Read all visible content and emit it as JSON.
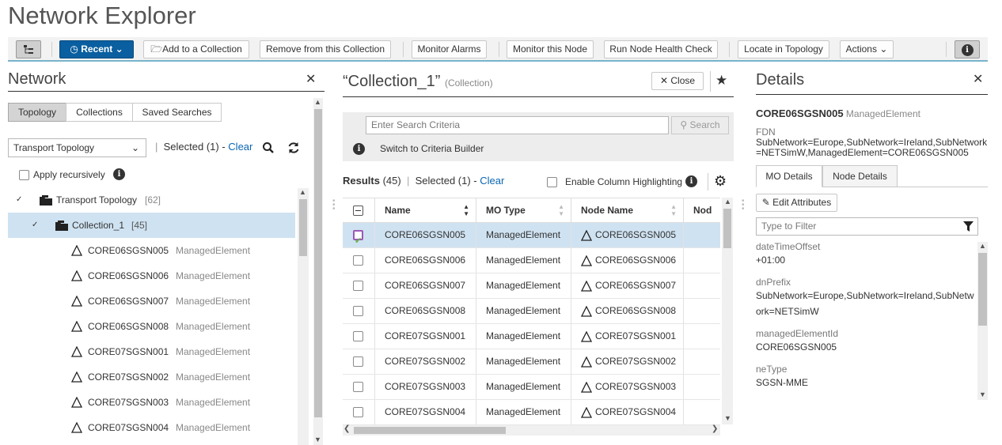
{
  "app": {
    "title": "Network Explorer"
  },
  "toolbar": {
    "recent_label": "Recent",
    "add_collection": "Add to a Collection",
    "remove_collection": "Remove from this Collection",
    "monitor_alarms": "Monitor Alarms",
    "monitor_node": "Monitor this Node",
    "health_check": "Run Node Health Check",
    "locate_topology": "Locate in Topology",
    "actions": "Actions"
  },
  "network": {
    "title": "Network",
    "tabs": [
      "Topology",
      "Collections",
      "Saved Searches"
    ],
    "active_tab": "Topology",
    "topology_select": "Transport Topology",
    "selected_text": "Selected (1) -",
    "clear": "Clear",
    "apply_recursively": "Apply recursively",
    "tree": {
      "root": {
        "label": "Transport Topology",
        "count": "[62]"
      },
      "collection": {
        "label": "Collection_1",
        "count": "[45]"
      },
      "nodes": [
        {
          "name": "CORE06SGSN005",
          "type": "ManagedElement"
        },
        {
          "name": "CORE06SGSN006",
          "type": "ManagedElement"
        },
        {
          "name": "CORE06SGSN007",
          "type": "ManagedElement"
        },
        {
          "name": "CORE06SGSN008",
          "type": "ManagedElement"
        },
        {
          "name": "CORE07SGSN001",
          "type": "ManagedElement"
        },
        {
          "name": "CORE07SGSN002",
          "type": "ManagedElement"
        },
        {
          "name": "CORE07SGSN003",
          "type": "ManagedElement"
        },
        {
          "name": "CORE07SGSN004",
          "type": "ManagedElement"
        }
      ]
    }
  },
  "collection": {
    "title": "“Collection_1”",
    "subtitle": "(Collection)",
    "close_label": "Close",
    "search_placeholder": "Enter Search Criteria",
    "search_button": "Search",
    "criteria_builder": "Switch to Criteria Builder",
    "results_label": "Results",
    "results_count": "(45)",
    "selected_text": "Selected (1) -",
    "clear": "Clear",
    "column_highlighting": "Enable Column Highlighting",
    "columns": [
      "Name",
      "MO Type",
      "Node Name",
      "Nod"
    ],
    "rows": [
      {
        "name": "CORE06SGSN005",
        "mo_type": "ManagedElement",
        "node_name": "CORE06SGSN005",
        "selected": true
      },
      {
        "name": "CORE06SGSN006",
        "mo_type": "ManagedElement",
        "node_name": "CORE06SGSN006",
        "selected": false
      },
      {
        "name": "CORE06SGSN007",
        "mo_type": "ManagedElement",
        "node_name": "CORE06SGSN007",
        "selected": false
      },
      {
        "name": "CORE06SGSN008",
        "mo_type": "ManagedElement",
        "node_name": "CORE06SGSN008",
        "selected": false
      },
      {
        "name": "CORE07SGSN001",
        "mo_type": "ManagedElement",
        "node_name": "CORE07SGSN001",
        "selected": false
      },
      {
        "name": "CORE07SGSN002",
        "mo_type": "ManagedElement",
        "node_name": "CORE07SGSN002",
        "selected": false
      },
      {
        "name": "CORE07SGSN003",
        "mo_type": "ManagedElement",
        "node_name": "CORE07SGSN003",
        "selected": false
      },
      {
        "name": "CORE07SGSN004",
        "mo_type": "ManagedElement",
        "node_name": "CORE07SGSN004",
        "selected": false
      }
    ]
  },
  "details": {
    "title": "Details",
    "element_name": "CORE06SGSN005",
    "element_type": "ManagedElement",
    "fdn_label": "FDN",
    "fdn_line1": "SubNetwork=Europe,SubNetwork=Ireland,SubNetwork",
    "fdn_line2": "=NETSimW,ManagedElement=CORE06SGSN005",
    "tabs": [
      "MO Details",
      "Node Details"
    ],
    "active_tab": "MO Details",
    "edit_attributes": "Edit Attributes",
    "filter_placeholder": "Type to Filter",
    "attributes": [
      {
        "label": "dateTimeOffset",
        "value": "+01:00"
      },
      {
        "label": "dnPrefix",
        "value": "SubNetwork=Europe,SubNetwork=Ireland,SubNetw",
        "value2": "ork=NETSimW"
      },
      {
        "label": "managedElementId",
        "value": "CORE06SGSN005"
      },
      {
        "label": "neType",
        "value": "SGSN-MME"
      }
    ]
  },
  "colors": {
    "accent": "#0a5fa0",
    "link": "#0a66b3",
    "selection": "#cfe2f1",
    "check": "#6ab04c",
    "check_border": "#9b59b6"
  }
}
